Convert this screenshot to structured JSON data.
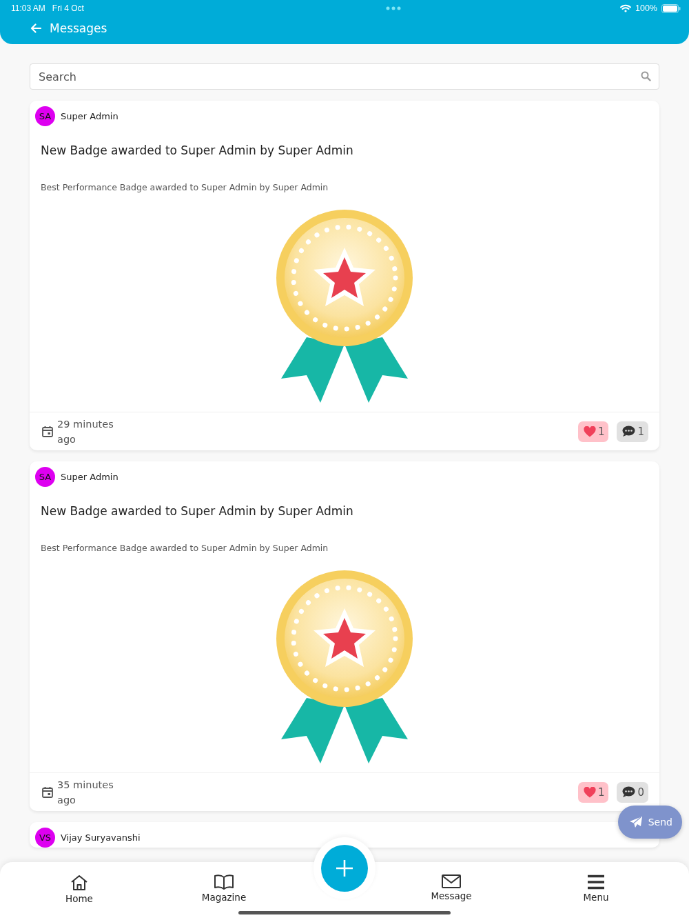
{
  "status_bar": {
    "time": "11:03 AM",
    "date": "Fri 4 Oct",
    "battery": "100%"
  },
  "header": {
    "title": "Messages"
  },
  "search": {
    "placeholder": "Search"
  },
  "posts": [
    {
      "initials": "SA",
      "author": "Super Admin",
      "title": "New Badge awarded to Super Admin by Super Admin",
      "description": "Best Performance Badge awarded to Super Admin by Super Admin",
      "time_line_1": "29 minutes",
      "time_line_2": "ago",
      "likes": "1",
      "comments": "1"
    },
    {
      "initials": "SA",
      "author": "Super Admin",
      "title": "New Badge awarded to Super Admin by Super Admin",
      "description": "Best Performance Badge awarded to Super Admin by Super Admin",
      "time_line_1": "35 minutes",
      "time_line_2": "ago",
      "likes": "1",
      "comments": "0"
    },
    {
      "initials": "VS",
      "author": "Vijay Suryavanshi"
    }
  ],
  "send_button": "Send",
  "bottom_nav": [
    {
      "label": "Home",
      "kind": "home"
    },
    {
      "label": "Magazine",
      "kind": "magazine"
    },
    {
      "label": "Message",
      "kind": "message"
    },
    {
      "label": "Menu",
      "kind": "menu"
    }
  ]
}
